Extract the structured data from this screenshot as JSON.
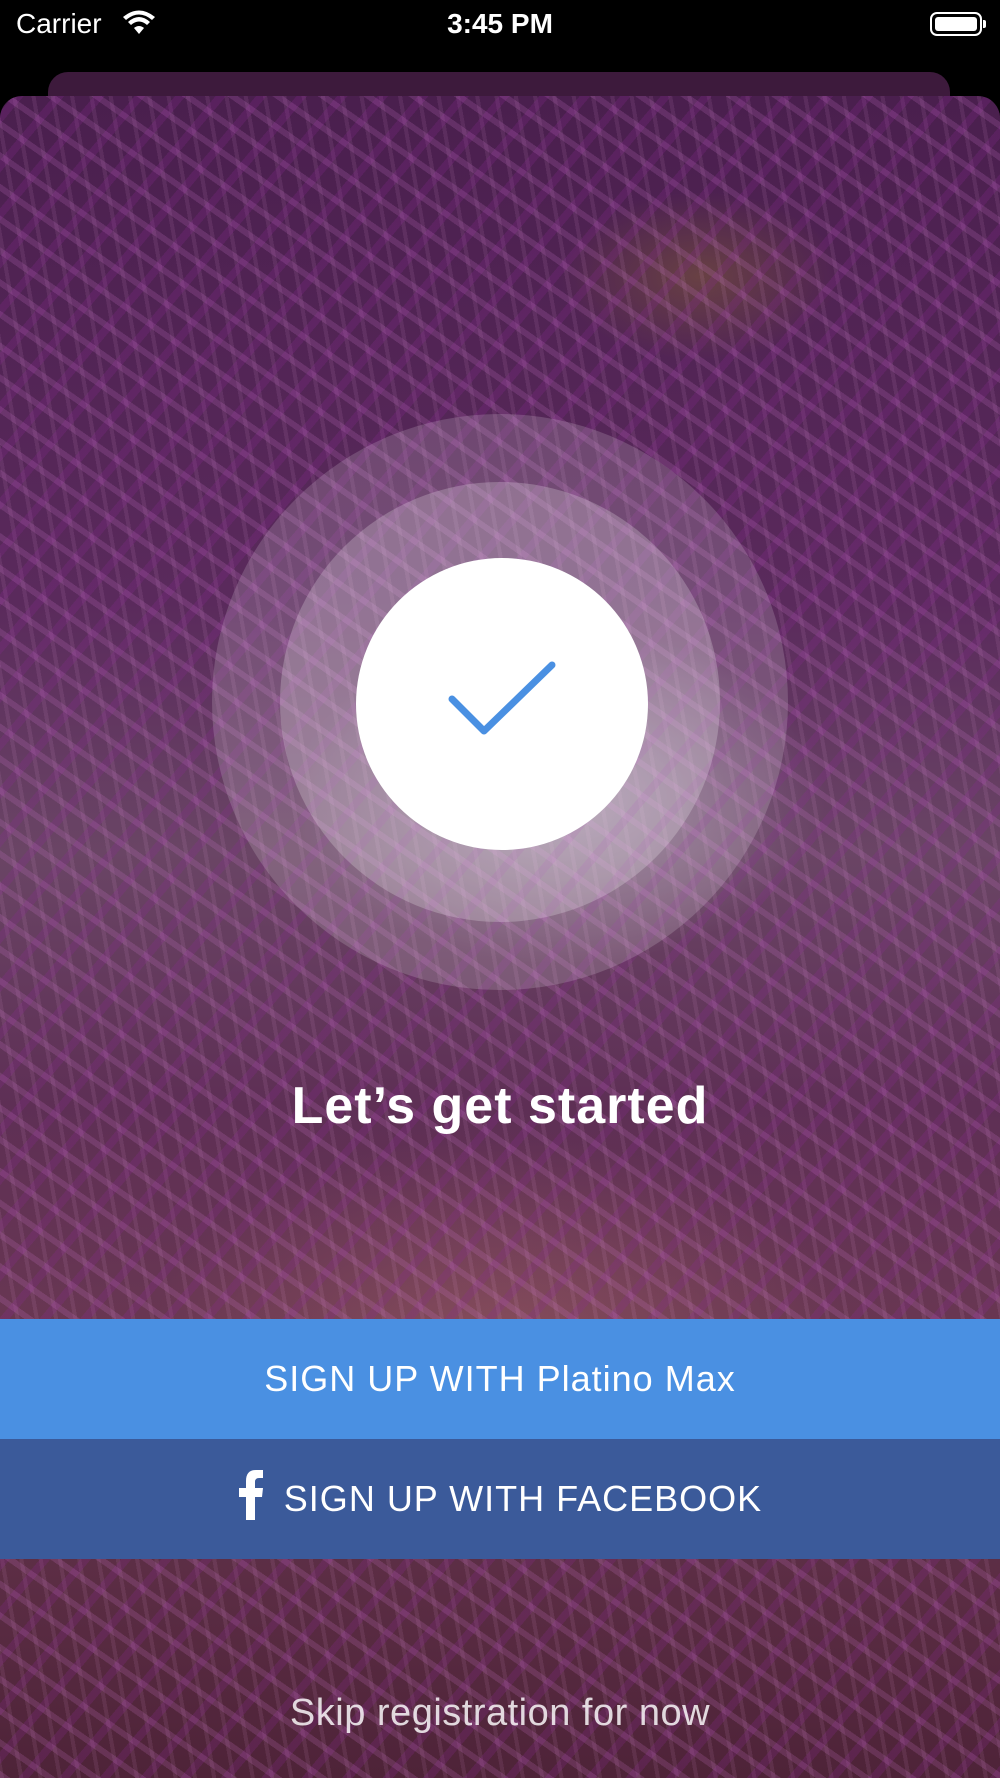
{
  "status_bar": {
    "carrier": "Carrier",
    "time": "3:45 PM",
    "icons": [
      "wifi-icon",
      "battery-icon"
    ]
  },
  "main": {
    "heading": "Let’s get started",
    "badge_icon": "checkmark-icon",
    "sign_up_platino_label": "SIGN UP WITH Platino Max",
    "sign_up_facebook_label": "SIGN UP WITH FACEBOOK",
    "facebook_icon": "facebook-icon",
    "skip_label": "Skip registration for now"
  },
  "colors": {
    "platino_button": "#4a90e2",
    "facebook_button": "#3b5a9a",
    "checkmark": "#4a90e2",
    "overlay": "#5a2a5c"
  }
}
